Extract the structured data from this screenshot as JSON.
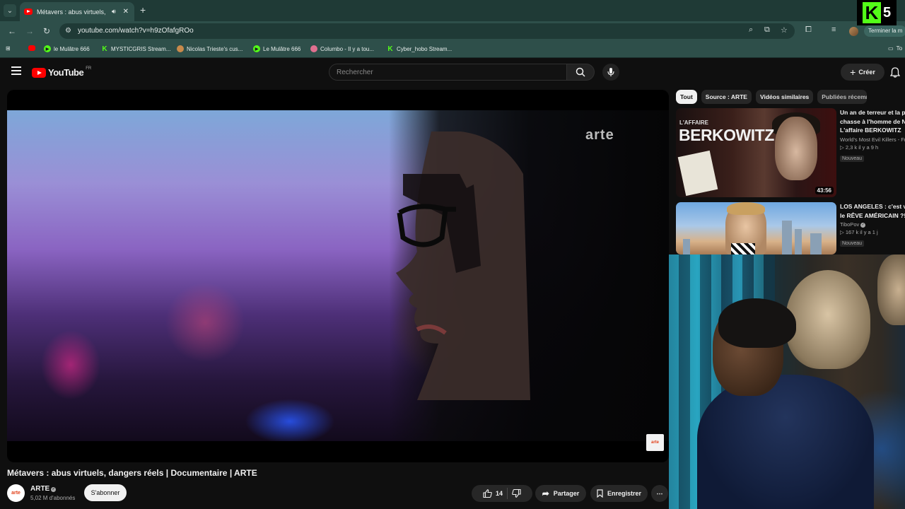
{
  "browser": {
    "tab": {
      "title": "Métavers : abus virtuels, dangers réels | Documentaire | ARTE",
      "audio_icon": "speaker-icon",
      "close": "✕"
    },
    "new_tab": "+",
    "url": "youtube.com/watch?v=h9zOfafgROo",
    "profile_action": "Terminer la m",
    "bookmarks": [
      {
        "label": "",
        "icon": "youtube"
      },
      {
        "label": "le Mulâtre 666",
        "icon": "play"
      },
      {
        "label": "MYSTICGRIS Stream...",
        "icon": "kick"
      },
      {
        "label": "Nicolas Trieste's cus...",
        "icon": "fox"
      },
      {
        "label": "Le Mulâtre 666",
        "icon": "play"
      },
      {
        "label": "Columbo - Il y a tou...",
        "icon": "pix"
      },
      {
        "label": "Cyber_hobo Stream...",
        "icon": "kick"
      }
    ],
    "bookmarks_folder": "To"
  },
  "overlay": {
    "brand_letter": "K",
    "number": "5"
  },
  "youtube": {
    "logo": "YouTube",
    "region": "FR",
    "search_placeholder": "Rechercher",
    "create_label": "Créer"
  },
  "video": {
    "watermark": "arte",
    "corner_logo": "arte",
    "title": "Métavers : abus virtuels, dangers réels | Documentaire | ARTE",
    "channel": "ARTE",
    "subscribers": "5,02 M d'abonnés",
    "subscribe_label": "S'abonner",
    "likes": "14",
    "share_label": "Partager",
    "save_label": "Enregistrer"
  },
  "chips": [
    "Tout",
    "Source : ARTE",
    "Vidéos similaires",
    "Publiées récemm"
  ],
  "recommendations": [
    {
      "title_lines": [
        "Un an de terreur et la pl",
        "chasse à l'homme de N",
        "L'affaire BERKOWITZ"
      ],
      "channel": "World's Most Evil Killers - Fr",
      "meta": "▷ 2,3 k   il y a 9 h",
      "badge": "Nouveau",
      "duration": "43:56",
      "thumb_small": "L'AFFAIRE",
      "thumb_big": "BERKOWITZ"
    },
    {
      "title_lines": [
        "LOS ANGELES : c'est vra",
        "le RÊVE AMÉRICAIN ?!"
      ],
      "channel": "TiboPov",
      "meta": "▷ 167 k   il y a 1 j",
      "badge": "Nouveau"
    }
  ],
  "colors": {
    "chrome": "#2e4f4a",
    "youtube_red": "#ff0000",
    "kick_green": "#53fc18",
    "arte_orange": "#e2411b"
  }
}
